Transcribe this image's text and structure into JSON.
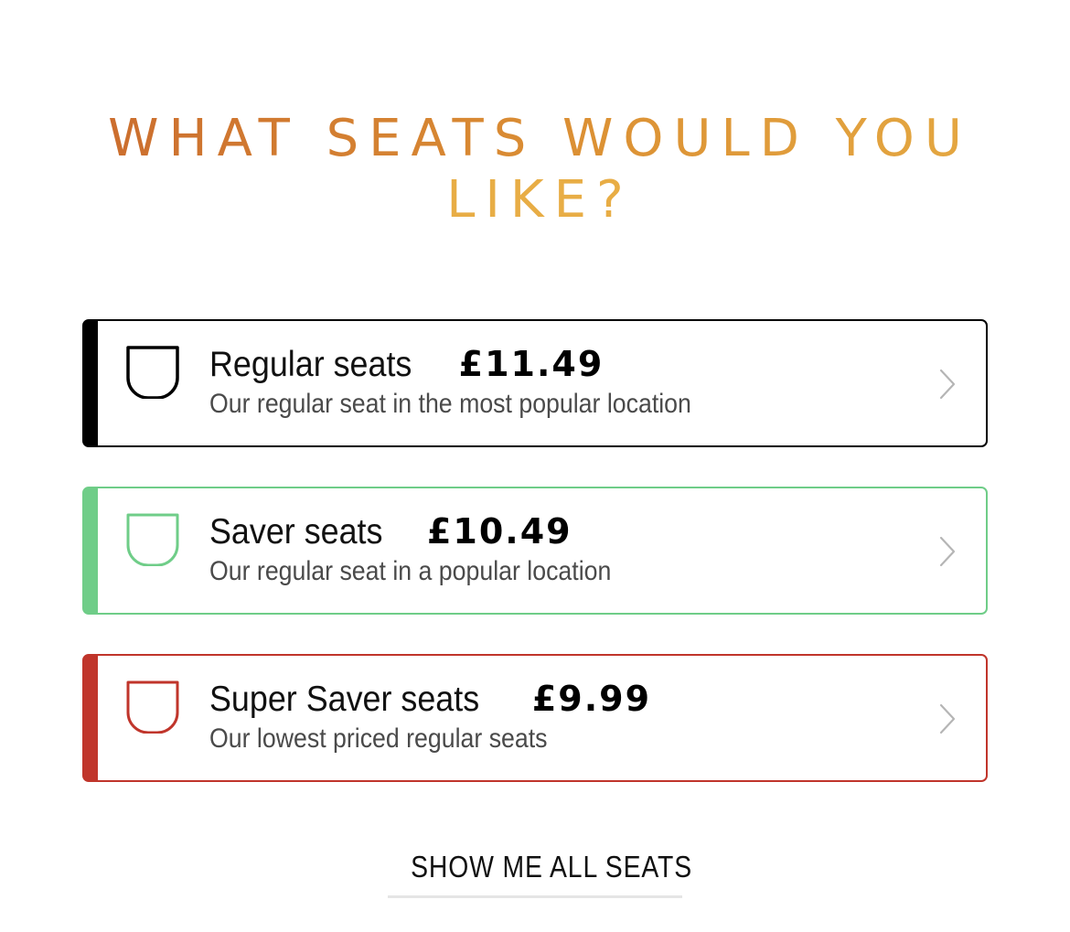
{
  "heading": {
    "line1": "WHAT SEATS WOULD YOU",
    "line2": "LIKE?"
  },
  "colors": {
    "heading_gradient": [
      "#c8672d",
      "#e6ad45"
    ],
    "regular": "#000000",
    "saver": "#6fcd88",
    "super_saver": "#c0352b",
    "chevron": "#b5b5b5"
  },
  "seat_options": [
    {
      "name": "Regular seats",
      "price": "£11.49",
      "description": "Our regular seat in the most popular location",
      "icon": "seat-icon",
      "color": "#000000"
    },
    {
      "name": "Saver seats",
      "price": "£10.49",
      "description": "Our regular seat in a popular location",
      "icon": "seat-icon",
      "color": "#6fcd88"
    },
    {
      "name": "Super Saver seats",
      "price": "£9.99",
      "description": "Our lowest priced regular seats",
      "icon": "seat-icon",
      "color": "#c0352b"
    }
  ],
  "show_all_label": "SHOW ME ALL SEATS"
}
